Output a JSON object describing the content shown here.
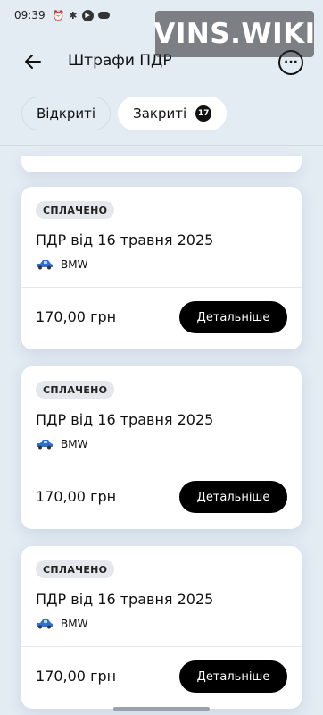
{
  "status_bar": {
    "time": "09:39",
    "icons": [
      "alarm-icon",
      "bluetooth-icon",
      "play-icon",
      "cloud-icon"
    ]
  },
  "watermark": {
    "text": "VINS.WIKI"
  },
  "header": {
    "back_icon": "arrow-left-icon",
    "title": "Штрафи ПДР",
    "more_icon": "more-horizontal-icon",
    "more_glyph": "···"
  },
  "tabs": [
    {
      "label": "Відкриті",
      "active": false
    },
    {
      "label": "Закриті",
      "active": true,
      "count": "17"
    }
  ],
  "fines": [
    {
      "status": "СПЛАЧЕНО",
      "title": "ПДР від 16 травня 2025",
      "vehicle": "BMW",
      "amount": "170,00 грн",
      "action": "Детальніше"
    },
    {
      "status": "СПЛАЧЕНО",
      "title": "ПДР від 16 травня 2025",
      "vehicle": "BMW",
      "amount": "170,00 грн",
      "action": "Детальніше"
    },
    {
      "status": "СПЛАЧЕНО",
      "title": "ПДР від 16 травня 2025",
      "vehicle": "BMW",
      "amount": "170,00 грн",
      "action": "Детальніше"
    }
  ],
  "colors": {
    "background": "#e3ebf3",
    "card": "#ffffff",
    "button": "#000000",
    "badge": "#e4e7eb",
    "car": "#2f6fd3"
  }
}
